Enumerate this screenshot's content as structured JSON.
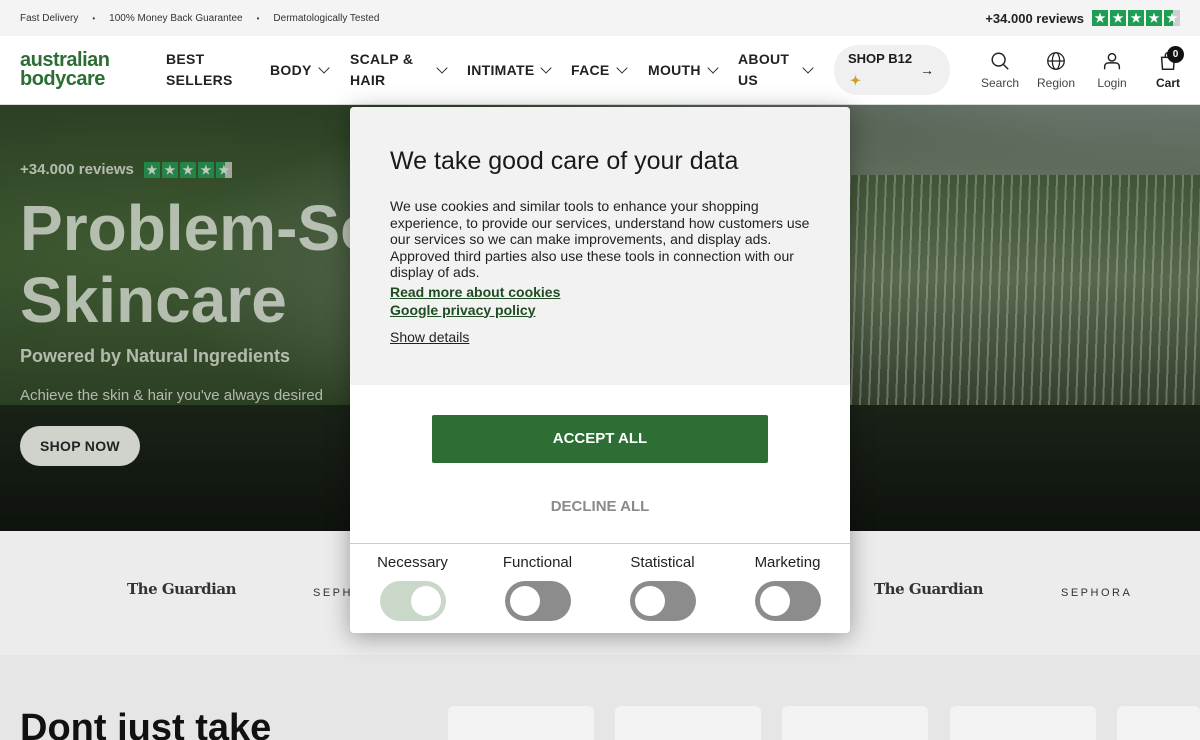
{
  "topbar": {
    "perks": [
      "Fast Delivery",
      "100% Money Back Guarantee",
      "Dermatologically Tested"
    ],
    "separator": "•",
    "reviews": "+34.000 reviews"
  },
  "header": {
    "logo_line1": "australian",
    "logo_line2": "bodycare",
    "nav": [
      {
        "line1": "BEST",
        "line2": "SELLERS"
      },
      {
        "line1": "BODY"
      },
      {
        "line1": "SCALP &",
        "line2": "HAIR"
      },
      {
        "line1": "INTIMATE"
      },
      {
        "line1": "FACE"
      },
      {
        "line1": "MOUTH"
      },
      {
        "line1": "ABOUT",
        "line2": "US"
      }
    ],
    "shop_b12": "SHOP B12",
    "icons": {
      "search": "Search",
      "region": "Region",
      "login": "Login",
      "cart": "Cart",
      "cart_count": "0"
    }
  },
  "hero": {
    "reviews": "+34.000 reviews",
    "title_line1": "Problem-Sc",
    "title_line2": "Skincare",
    "subtitle": "Powered by Natural Ingredients",
    "description": "Achieve the skin & hair you've always desired",
    "cta": "SHOP NOW"
  },
  "press": {
    "guardian_1": "The Guardian",
    "sephora_1": "SEPH",
    "guardian_2": "The Guardian",
    "sephora_2": "SEPHORA"
  },
  "bottom": {
    "title": "Dont just take"
  },
  "consent": {
    "title": "We take good care of your data",
    "body": "We use cookies and similar tools to enhance your shopping experience, to provide our services, understand how customers use our services so we can make improvements, and display ads. Approved third parties also use these tools in connection with our display of ads.",
    "link_cookies": "Read more about cookies",
    "link_google": "Google privacy policy",
    "show_details": "Show details",
    "accept": "ACCEPT ALL",
    "decline": "DECLINE ALL",
    "categories": [
      {
        "label": "Necessary",
        "state": "on-disabled"
      },
      {
        "label": "Functional",
        "state": "off"
      },
      {
        "label": "Statistical",
        "state": "off"
      },
      {
        "label": "Marketing",
        "state": "off"
      }
    ]
  },
  "colors": {
    "brand": "#2c6e34",
    "trustpilot": "#1f9d55"
  }
}
